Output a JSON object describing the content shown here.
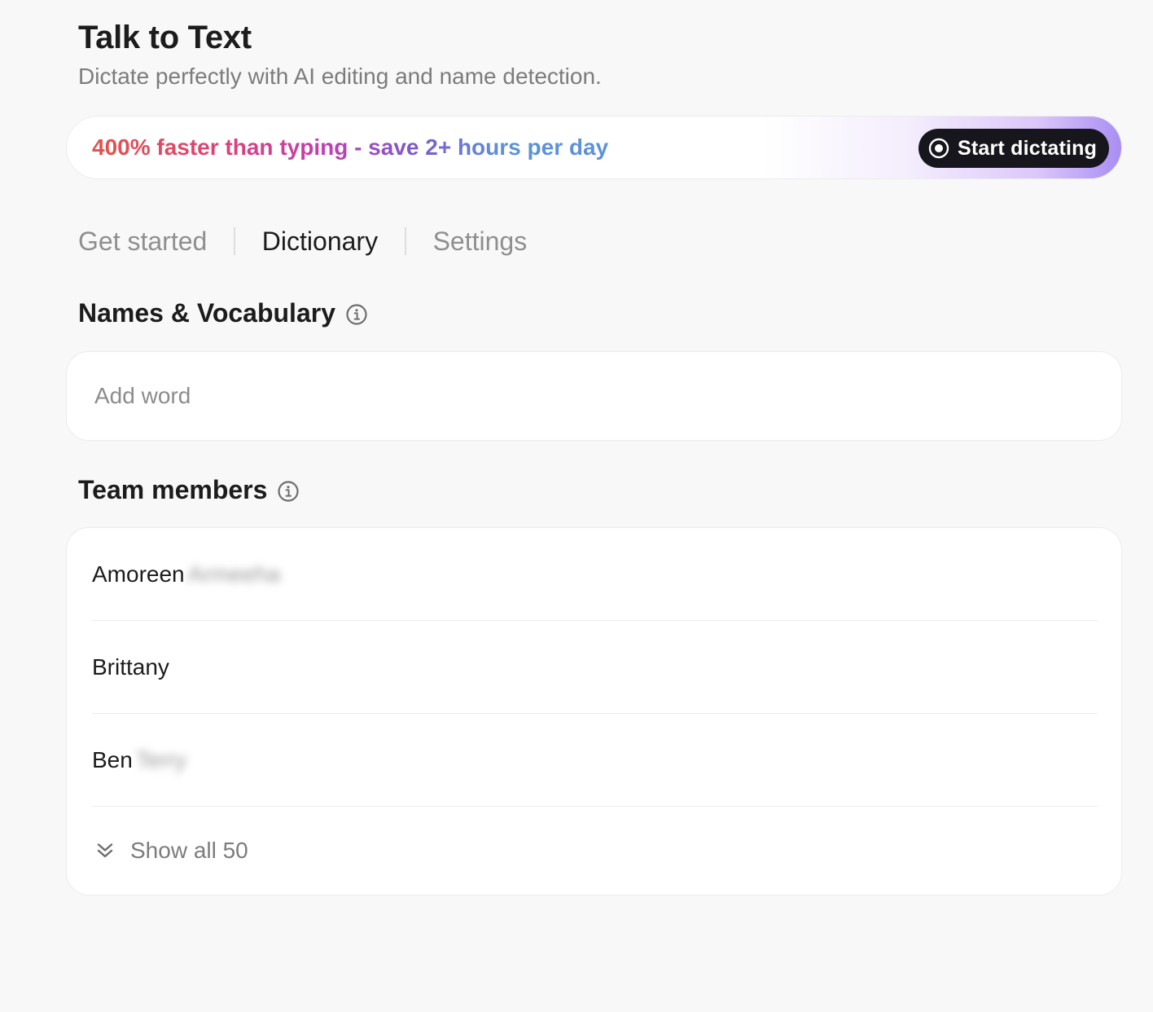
{
  "header": {
    "title": "Talk to Text",
    "subtitle": "Dictate perfectly with AI editing and name detection."
  },
  "promo": {
    "text": "400% faster than typing - save 2+ hours per day",
    "button_label": "Start dictating",
    "button_icon": "record-icon"
  },
  "tabs": [
    {
      "label": "Get started",
      "active": false
    },
    {
      "label": "Dictionary",
      "active": true
    },
    {
      "label": "Settings",
      "active": false
    }
  ],
  "vocabulary": {
    "title": "Names & Vocabulary",
    "icon": "info-icon",
    "input_placeholder": "Add word"
  },
  "team": {
    "title": "Team members",
    "icon": "info-icon",
    "members": [
      {
        "first": "Amoreen",
        "last": "Armeeha"
      },
      {
        "first": "Brittany",
        "last": ""
      },
      {
        "first": "Ben",
        "last": "Terry"
      }
    ],
    "show_all_label": "Show all 50",
    "show_all_icon": "chevrons-down-icon"
  },
  "colors": {
    "background": "#f8f8f8",
    "button": "#17161c",
    "accent_purple": "#a98ef3"
  }
}
